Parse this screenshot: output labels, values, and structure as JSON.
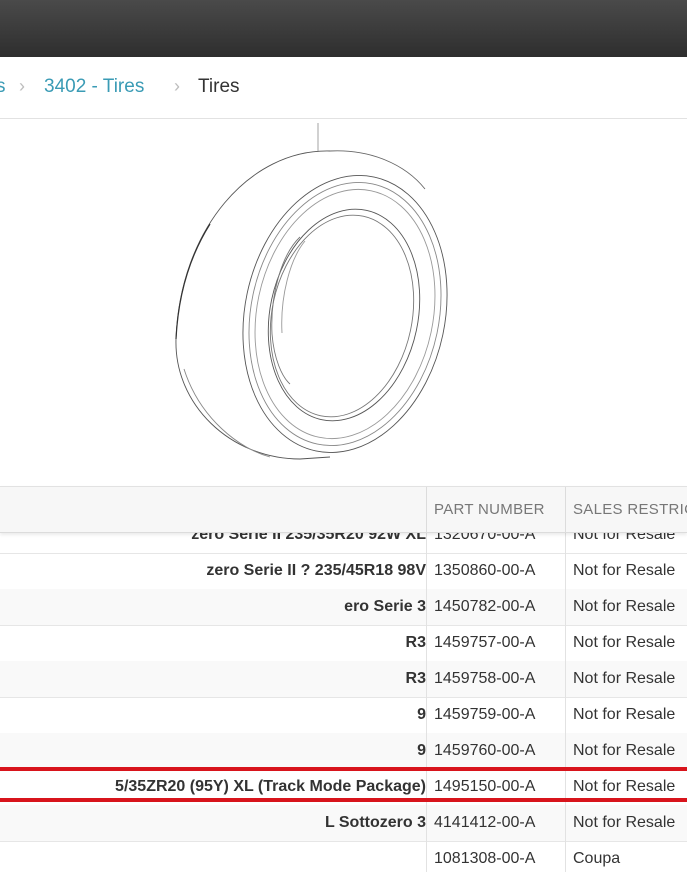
{
  "breadcrumb": {
    "prev_partial": "s",
    "category": "3402 - Tires",
    "current": "Tires"
  },
  "table": {
    "columns": [
      "PART NUMBER",
      "SALES RESTRIC"
    ],
    "rows": [
      {
        "description": "zero Serie II 235/35R20 92W XL",
        "part_number": "1320670-00-A",
        "sales_restriction": "Not for Resale"
      },
      {
        "description": "zero Serie II ? 235/45R18 98V",
        "part_number": "1350860-00-A",
        "sales_restriction": "Not for Resale"
      },
      {
        "description": "ero Serie 3",
        "part_number": "1450782-00-A",
        "sales_restriction": "Not for Resale"
      },
      {
        "description": "R3",
        "part_number": "1459757-00-A",
        "sales_restriction": "Not for Resale"
      },
      {
        "description": "R3",
        "part_number": "1459758-00-A",
        "sales_restriction": "Not for Resale"
      },
      {
        "description": "9",
        "part_number": "1459759-00-A",
        "sales_restriction": "Not for Resale"
      },
      {
        "description": "9",
        "part_number": "1459760-00-A",
        "sales_restriction": "Not for Resale"
      },
      {
        "description": "5/35ZR20 (95Y) XL (Track Mode Package)",
        "part_number": "1495150-00-A",
        "sales_restriction": "Not for Resale"
      },
      {
        "description": "L Sottozero 3",
        "part_number": "4141412-00-A",
        "sales_restriction": "Not for Resale"
      },
      {
        "description": "",
        "part_number": "1081308-00-A",
        "sales_restriction": "Coupa"
      }
    ]
  },
  "colors": {
    "link": "#3a9bb5",
    "highlight": "#d8141c"
  }
}
